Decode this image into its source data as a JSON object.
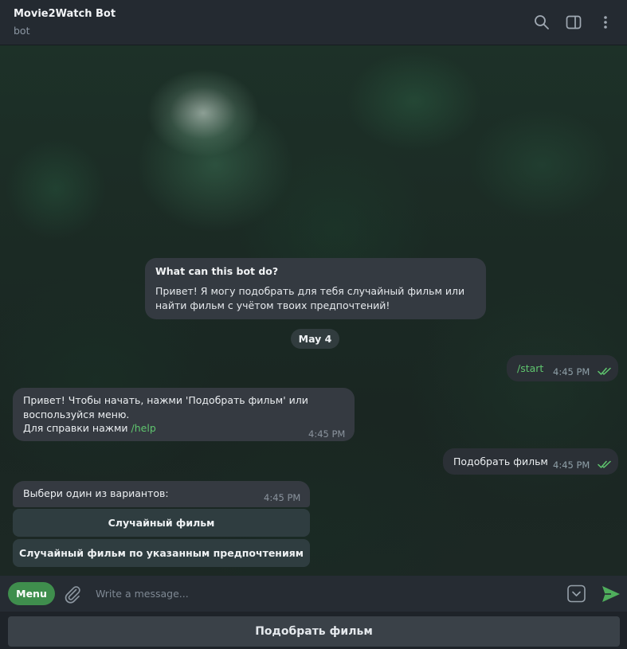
{
  "header": {
    "title": "Movie2Watch Bot",
    "subtitle": "bot",
    "icons": [
      "search-icon",
      "sidebar-toggle-icon",
      "more-vertical-icon"
    ]
  },
  "intro": {
    "title": "What can this bot do?",
    "text": "Привет! Я могу подобрать для тебя случайный фильм или найти фильм с учётом твоих предпочтений!"
  },
  "date_separator": "May 4",
  "messages": [
    {
      "direction": "outgoing",
      "text": "/start",
      "time": "4:45 PM",
      "status": "read"
    },
    {
      "direction": "incoming",
      "line1": "Привет! Чтобы начать, нажми 'Подобрать фильм' или",
      "line2": "воспользуйся меню.",
      "line3_prefix": "Для справки нажми ",
      "line3_link": "/help",
      "time": "4:45 PM"
    },
    {
      "direction": "outgoing",
      "text": "Подобрать фильм",
      "time": "4:45 PM",
      "status": "read"
    },
    {
      "direction": "incoming",
      "text": "Выбери один из вариантов:",
      "time": "4:45 PM"
    }
  ],
  "inline_keyboard": [
    {
      "label": "Случайный фильм"
    },
    {
      "label": "Случайный фильм по указанным предпочтениям"
    }
  ],
  "composer": {
    "menu_label": "Menu",
    "placeholder": "Write a message...",
    "value": ""
  },
  "reply_keyboard": {
    "label": "Подобрать фильм"
  },
  "colors": {
    "accent": "#3f8e4d",
    "link": "#5fc56e",
    "read_check": "#5fc56e"
  }
}
